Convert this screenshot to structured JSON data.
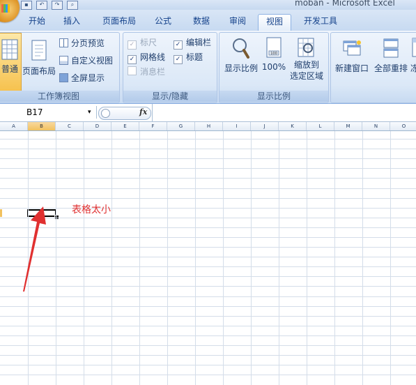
{
  "window": {
    "title": "moban - Microsoft Excel"
  },
  "quick_access": {
    "save_icon": "save-icon",
    "undo_icon": "undo-icon",
    "redo_icon": "redo-icon",
    "print_preview_icon": "print-preview-icon"
  },
  "tabs": [
    {
      "label": "开始"
    },
    {
      "label": "插入"
    },
    {
      "label": "页面布局"
    },
    {
      "label": "公式"
    },
    {
      "label": "数据"
    },
    {
      "label": "审阅"
    },
    {
      "label": "视图",
      "active": true
    },
    {
      "label": "开发工具"
    }
  ],
  "ribbon": {
    "workbook_views": {
      "label": "工作簿视图",
      "normal": "普通",
      "page_layout": "页面布局",
      "page_break_preview": "分页预览",
      "custom_views": "自定义视图",
      "full_screen": "全屏显示"
    },
    "show_hide": {
      "label": "显示/隐藏",
      "ruler": "标尺",
      "gridlines": "网格线",
      "message_bar": "消息栏",
      "formula_bar": "编辑栏",
      "headings": "标题",
      "check": "✓"
    },
    "zoom": {
      "label": "显示比例",
      "zoom": "显示比例",
      "hundred": "100%",
      "zoom_to_selection_1": "缩放到",
      "zoom_to_selection_2": "选定区域"
    },
    "window": {
      "new_window": "新建窗口",
      "arrange_all": "全部重排",
      "freeze": "冻"
    }
  },
  "formula_bar": {
    "name_box": "B17",
    "dropdown": "▾",
    "fx": "fx"
  },
  "sheet": {
    "columns": [
      "A",
      "B",
      "C",
      "D",
      "E",
      "F",
      "G",
      "H",
      "I",
      "J",
      "K",
      "L",
      "M",
      "N",
      "O"
    ],
    "active_column": "B",
    "active_cell": "B17"
  },
  "annotation": {
    "text": "表格太小",
    "color": "#e03030"
  },
  "colors": {
    "accent": "#15428b",
    "ribbon": "#dbe8f7",
    "annotation": "#e03030"
  }
}
